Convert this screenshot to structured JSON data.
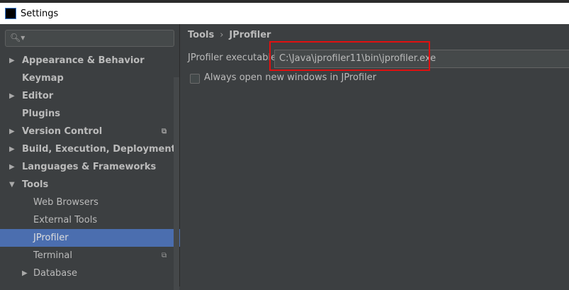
{
  "window": {
    "title": "Settings",
    "logo": "IJ"
  },
  "search": {
    "icon": "search-icon",
    "placeholder": ""
  },
  "sidebar": {
    "items": [
      {
        "label": "Appearance & Behavior",
        "bold": true,
        "arrow": "▶"
      },
      {
        "label": "Keymap",
        "bold": true
      },
      {
        "label": "Editor",
        "bold": true,
        "arrow": "▶"
      },
      {
        "label": "Plugins",
        "bold": true
      },
      {
        "label": "Version Control",
        "bold": true,
        "arrow": "▶",
        "copy": true
      },
      {
        "label": "Build, Execution, Deployment",
        "bold": true,
        "arrow": "▶"
      },
      {
        "label": "Languages & Frameworks",
        "bold": true,
        "arrow": "▶"
      },
      {
        "label": "Tools",
        "bold": true,
        "arrow": "▼"
      },
      {
        "label": "Web Browsers"
      },
      {
        "label": "External Tools"
      },
      {
        "label": "JProfiler",
        "selected": true
      },
      {
        "label": "Terminal",
        "copy": true
      },
      {
        "label": "Database",
        "arrow": "▶"
      }
    ]
  },
  "main": {
    "breadcrumb": [
      "Tools",
      "JProfiler"
    ],
    "breadcrumb_sep": "›",
    "executable_label": "JProfiler executable",
    "executable_value": "C:\\Java\\jprofiler11\\bin\\jprofiler.exe",
    "checkbox_label": "Always open new windows in JProfiler",
    "checkbox_checked": false
  },
  "colors": {
    "selection": "#4b6eaf",
    "highlight": "#e01010"
  }
}
